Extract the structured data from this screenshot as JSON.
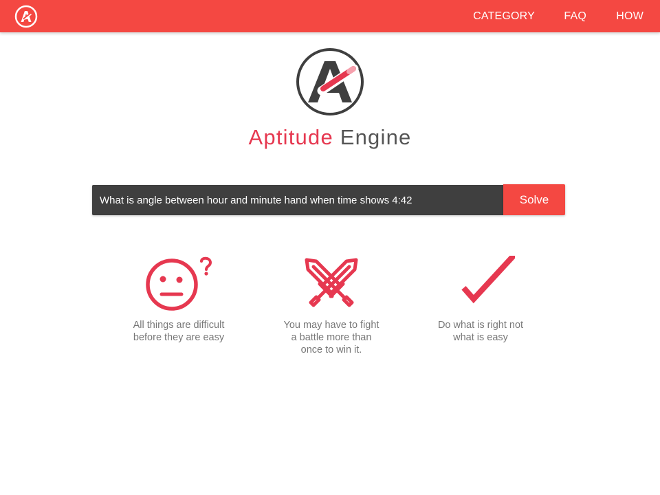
{
  "brand": {
    "name_part1": "Aptitude",
    "name_part2": "Engine",
    "icon": "aptitude-engine-logo-icon"
  },
  "nav": {
    "items": [
      {
        "label": "CATEGORY"
      },
      {
        "label": "FAQ"
      },
      {
        "label": "HOW"
      }
    ]
  },
  "search": {
    "value": "What is angle between hour and minute hand when time shows 4:42",
    "button_label": "Solve"
  },
  "features": [
    {
      "icon": "confused-face-icon",
      "text": "All things are difficult before they are easy"
    },
    {
      "icon": "crossed-swords-icon",
      "text": "You may have to fight a battle more than once to win it."
    },
    {
      "icon": "checkmark-icon",
      "text": "Do what is right not what is easy"
    }
  ],
  "colors": {
    "topbar": "#f44842",
    "accent": "#e63850",
    "input_bg": "#3f3f3f",
    "text_gray": "#777777"
  }
}
